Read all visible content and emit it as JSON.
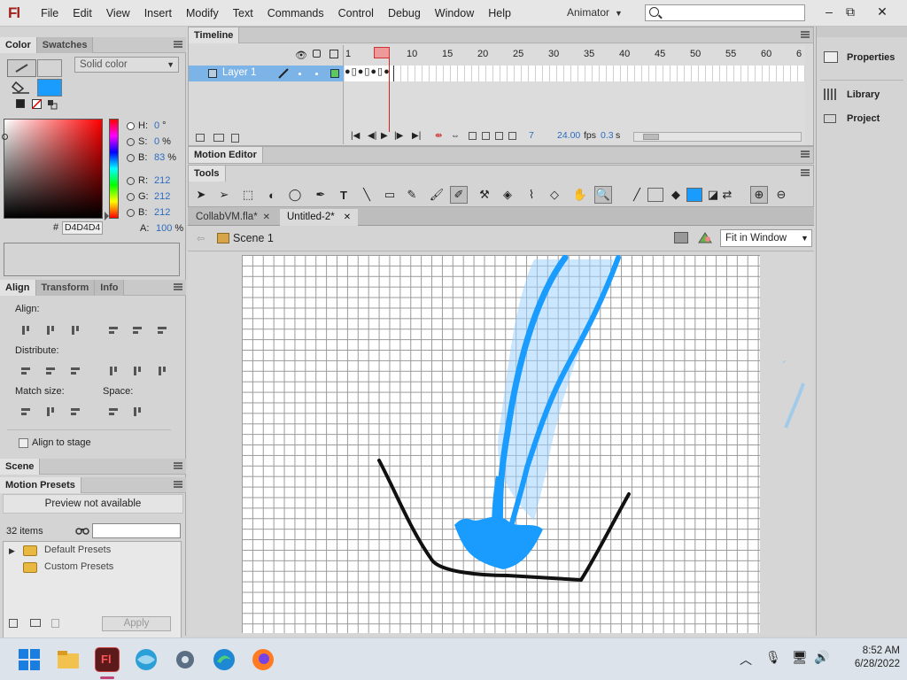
{
  "app": {
    "logo": "Fl",
    "menu": [
      "File",
      "Edit",
      "View",
      "Insert",
      "Modify",
      "Text",
      "Commands",
      "Control",
      "Debug",
      "Window",
      "Help"
    ],
    "workspace": "Animator",
    "search_placeholder": "",
    "window_buttons": [
      "–",
      "⧉",
      "✕"
    ]
  },
  "color_panel": {
    "tabs": [
      "Color",
      "Swatches"
    ],
    "fill_type": "Solid color",
    "hsb": [
      {
        "label": "H:",
        "value": "0",
        "unit": "°"
      },
      {
        "label": "S:",
        "value": "0",
        "unit": "%"
      },
      {
        "label": "B:",
        "value": "83",
        "unit": "%"
      }
    ],
    "rgb": [
      {
        "label": "R:",
        "value": "212"
      },
      {
        "label": "G:",
        "value": "212"
      },
      {
        "label": "B:",
        "value": "212"
      }
    ],
    "hex_label": "#",
    "hex": "D4D4D4",
    "alpha_label": "A:",
    "alpha": "100",
    "alpha_unit": "%",
    "fill_color": "#1a9cff"
  },
  "align_panel": {
    "tabs": [
      "Align",
      "Transform",
      "Info"
    ],
    "align_label": "Align:",
    "distribute_label": "Distribute:",
    "match_label": "Match size:",
    "space_label": "Space:",
    "align_to_stage": "Align to stage"
  },
  "scene_panel": {
    "title": "Scene"
  },
  "motion_presets": {
    "title": "Motion Presets",
    "preview": "Preview not available",
    "count": "32 items",
    "folders": [
      "Default Presets",
      "Custom Presets"
    ],
    "apply": "Apply"
  },
  "timeline": {
    "title": "Timeline",
    "layer_name": "Layer 1",
    "frame_numbers": [
      "1",
      "10",
      "15",
      "20",
      "25",
      "30",
      "35",
      "40",
      "45",
      "50",
      "55",
      "60",
      "6"
    ],
    "current_frame": "7",
    "fps": "24.00",
    "fps_unit": "fps",
    "time": "0.3",
    "time_unit": "s"
  },
  "motion_editor": {
    "title": "Motion Editor"
  },
  "tools_panel": {
    "title": "Tools"
  },
  "documents": {
    "tabs": [
      {
        "label": "CollabVM.fla*",
        "active": false
      },
      {
        "label": "Untitled-2*",
        "active": true
      }
    ],
    "scene": "Scene 1",
    "zoom": "Fit in Window"
  },
  "right_panel": {
    "items": [
      "Properties",
      "Library",
      "Project"
    ]
  },
  "taskbar": {
    "time": "8:52 AM",
    "date": "6/28/2022"
  }
}
